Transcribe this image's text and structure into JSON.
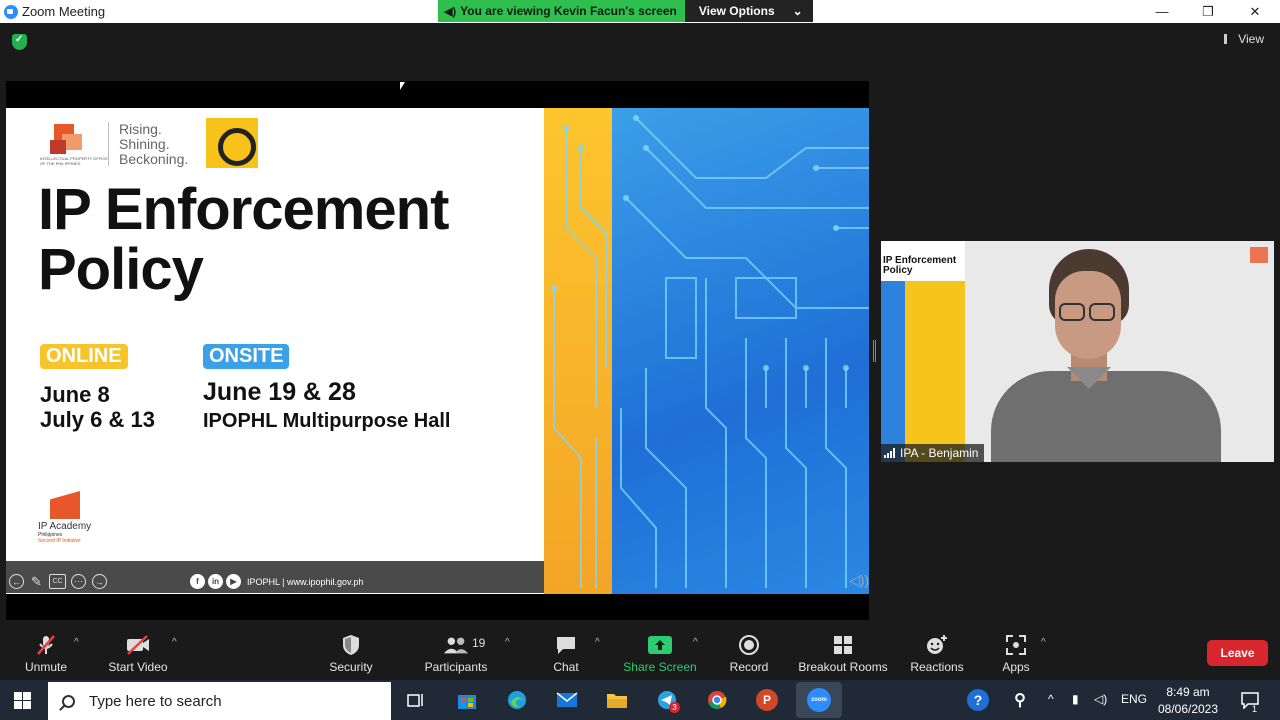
{
  "window": {
    "title": "Zoom Meeting",
    "minimize": "—",
    "restore": "❐",
    "close": "✕"
  },
  "share_banner": {
    "status": "You are viewing Kevin Facun's screen",
    "view_options": "View Options"
  },
  "view_button": "View",
  "slide": {
    "tagline": [
      "Rising.",
      "Shining.",
      "Beckoning."
    ],
    "ipo_caption": "INTELLECTUAL PROPERTY OFFICE OF THE PHILIPPINES",
    "title_line1": "IP Enforcement",
    "title_line2": "Policy",
    "online_label": "ONLINE",
    "online_dates": [
      "June 8",
      "July 6 & 13"
    ],
    "onsite_label": "ONSITE",
    "onsite_dates": "June 19 & 28",
    "venue": "IPOPHL Multipurpose Hall",
    "academy_name": "IP Academy",
    "academy_sub": "Philippines",
    "academy_tag": "Second IP Initiative",
    "social_text": "IPOPHL | www.ipophil.gov.ph",
    "social_icons": [
      "f",
      "in",
      "▶"
    ],
    "controls": [
      "←",
      "✎",
      "CC",
      "⋯",
      "→"
    ]
  },
  "participant_video": {
    "name": "IPA - Benjamin",
    "thumb_title": [
      "IP Enforcement",
      "Policy"
    ]
  },
  "toolbar": {
    "unmute": "Unmute",
    "start_video": "Start Video",
    "security": "Security",
    "participants": "Participants",
    "participants_count": "19",
    "chat": "Chat",
    "share_screen": "Share Screen",
    "record": "Record",
    "breakout_rooms": "Breakout Rooms",
    "reactions": "Reactions",
    "apps": "Apps",
    "leave": "Leave"
  },
  "taskbar": {
    "search_placeholder": "Type here to search",
    "telegram_badge": "3",
    "powerpoint_label": "P",
    "zoom_label": "zoom",
    "language": "ENG",
    "time": "8:49 am",
    "date": "08/06/2023",
    "notification_count": "1"
  },
  "colors": {
    "share_green": "#2fbf4f",
    "leave_red": "#d7262c",
    "share_screen_green": "#2ecc71",
    "slide_yellow": "#f7c52b",
    "slide_blue": "#3aa0e8"
  }
}
